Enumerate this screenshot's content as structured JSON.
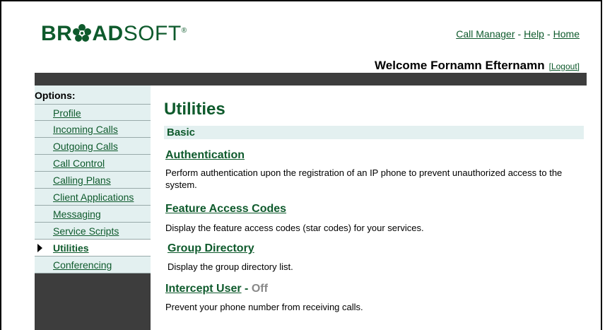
{
  "brand": {
    "logo_bold": "BR",
    "logo_bold2": "AD",
    "logo_thin": "SOFT",
    "logo_mark": "®",
    "flower_icon": "flower-logo-icon",
    "color": "#0e5a2c"
  },
  "topnav": {
    "items": [
      "Call Manager",
      "Help",
      "Home"
    ],
    "separator": "-"
  },
  "welcome": {
    "text": "Welcome Fornamn Efternamn",
    "logout": "[Logout]"
  },
  "sidebar": {
    "title": "Options:",
    "items": [
      {
        "label": "Profile"
      },
      {
        "label": "Incoming Calls"
      },
      {
        "label": "Outgoing Calls"
      },
      {
        "label": "Call Control"
      },
      {
        "label": "Calling Plans"
      },
      {
        "label": "Client Applications"
      },
      {
        "label": "Messaging"
      },
      {
        "label": "Service Scripts"
      },
      {
        "label": "Utilities"
      },
      {
        "label": "Conferencing"
      }
    ],
    "current": "Utilities"
  },
  "main": {
    "title": "Utilities",
    "section": "Basic",
    "utilities": [
      {
        "name": "Authentication",
        "status": "",
        "description": "Perform authentication upon the registration of an IP phone to prevent unauthorized access to the system."
      },
      {
        "name": "Feature Access Codes",
        "status": "",
        "description": "Display the feature access codes (star codes) for your services."
      },
      {
        "name": "Group Directory",
        "status": "",
        "description": "Display the group directory list."
      },
      {
        "name": "Intercept User",
        "status_sep": " - ",
        "status": "Off",
        "description": "Prevent your phone number from receiving calls."
      }
    ]
  },
  "colors": {
    "accent": "#0e5a2c",
    "sidebar_bg": "#3d3d3d",
    "panel_bg": "#e3f0f0",
    "status_off": "#888888"
  }
}
